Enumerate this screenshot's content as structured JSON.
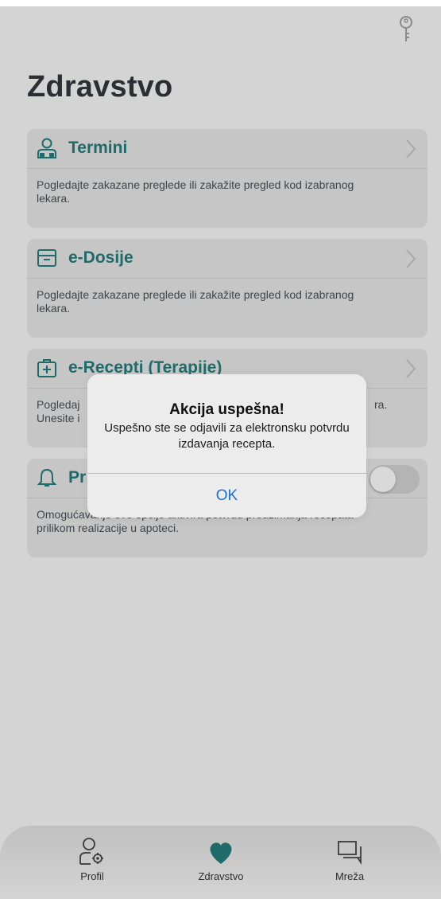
{
  "page": {
    "title": "Zdravstvo"
  },
  "cards": [
    {
      "title": "Termini",
      "description": "Pogledajte zakazane preglede ili zakažite pregled kod izabranog lekara.",
      "icon": "doctor-person-icon"
    },
    {
      "title": "e-Dosije",
      "description": "Pogledajte zakazane preglede ili zakažite pregled kod izabranog lekara.",
      "icon": "archive-box-icon"
    },
    {
      "title": "e-Recepti (Terapije)",
      "description_line1": "Pogledaj",
      "description_line1_end": "ra.",
      "description_line2": "Unesite i",
      "icon": "medical-kit-icon"
    },
    {
      "title_visible": "Pr",
      "description": "Omogućavanje ove opcije aktivira potvrdu preuzimanja recepata prilikom realizacije u apoteci.",
      "icon": "bell-icon",
      "toggle_on": false
    }
  ],
  "alert": {
    "title": "Akcija uspešna!",
    "message": "Uspešno ste se odjavili za elektronsku potvrdu izdavanja recepta.",
    "ok_label": "OK"
  },
  "tabs": [
    {
      "label": "Profil",
      "icon": "profile-settings-icon"
    },
    {
      "label": "Zdravstvo",
      "icon": "heart-icon",
      "active": true
    },
    {
      "label": "Mreža",
      "icon": "chat-bubbles-icon"
    }
  ],
  "colors": {
    "accent": "#1f6b6a",
    "alert_button": "#1a6fd6",
    "dim_background": "#d4d4d4"
  }
}
